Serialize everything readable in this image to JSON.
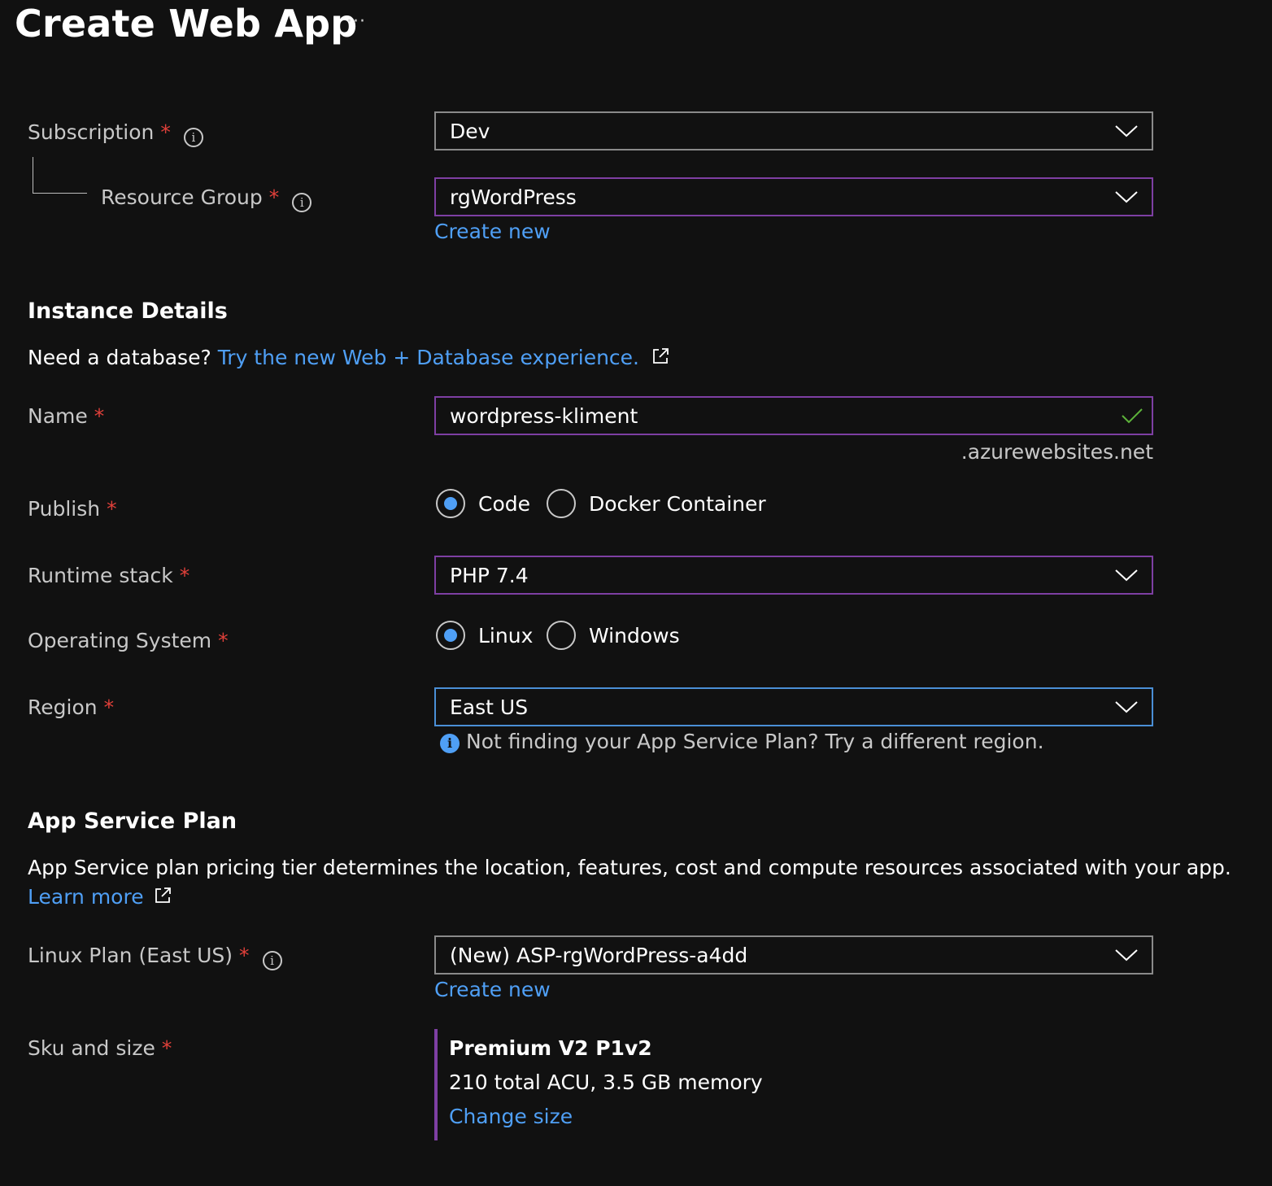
{
  "header": {
    "title": "Create Web App",
    "more": "···"
  },
  "project": {
    "subscription_label": "Subscription",
    "subscription_value": "Dev",
    "resource_group_label": "Resource Group",
    "resource_group_value": "rgWordPress",
    "create_new": "Create new"
  },
  "required_mark": "*",
  "info_glyph": "i",
  "instance": {
    "heading": "Instance Details",
    "db_prompt": "Need a database?",
    "db_link": "Try the new Web + Database experience.",
    "name_label": "Name",
    "name_value": "wordpress-kliment",
    "name_suffix": ".azurewebsites.net",
    "publish_label": "Publish",
    "publish_options": [
      "Code",
      "Docker Container"
    ],
    "publish_selected": "Code",
    "runtime_label": "Runtime stack",
    "runtime_value": "PHP 7.4",
    "os_label": "Operating System",
    "os_options": [
      "Linux",
      "Windows"
    ],
    "os_selected": "Linux",
    "region_label": "Region",
    "region_value": "East US",
    "region_hint": "Not finding your App Service Plan? Try a different region."
  },
  "plan": {
    "heading": "App Service Plan",
    "description": "App Service plan pricing tier determines the location, features, cost and compute resources associated with your app.",
    "learn_more": "Learn more",
    "linux_plan_label": "Linux Plan (East US)",
    "linux_plan_value": "(New) ASP-rgWordPress-a4dd",
    "create_new": "Create new",
    "sku_label": "Sku and size",
    "sku_name": "Premium V2 P1v2",
    "sku_details": "210 total ACU, 3.5 GB memory",
    "change_size": "Change size"
  },
  "colors": {
    "background": "#111111",
    "link": "#4f9ff5",
    "required": "#e0403a",
    "focus_border": "#7e3fa3",
    "active_border": "#4a8fd6",
    "valid_check": "#5db33a"
  }
}
